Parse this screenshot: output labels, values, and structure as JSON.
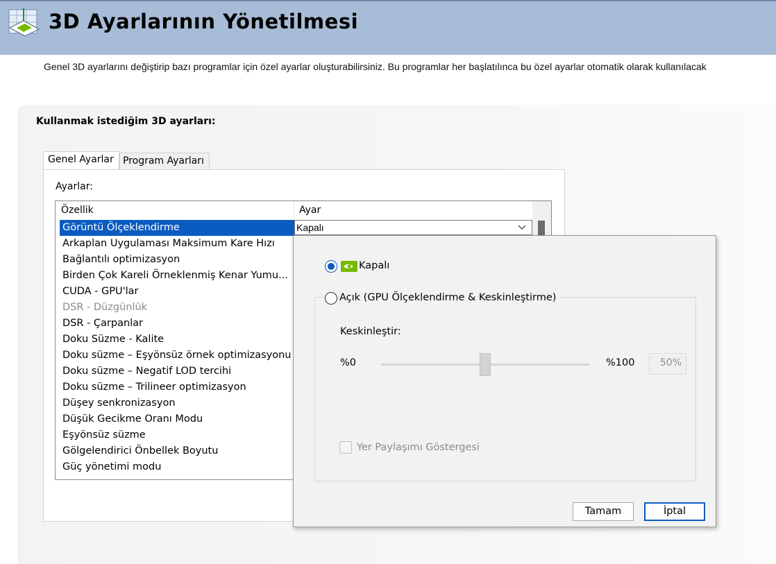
{
  "header": {
    "title": "3D Ayarlarının Yönetilmesi",
    "logo_icon": "nvidia-3d-settings-icon"
  },
  "description": "Genel 3D ayarlarını değiştirip bazı programlar için özel ayarlar oluşturabilirsiniz. Bu programlar her başlatılınca bu özel ayarlar otomatik olarak kullanılacak",
  "section_label": "Kullanmak istediğim 3D ayarları:",
  "tabs": [
    {
      "label": "Genel Ayarlar"
    },
    {
      "label": "Program Ayarları"
    }
  ],
  "settings_label": "Ayarlar:",
  "table": {
    "headers": {
      "feature": "Özellik",
      "setting": "Ayar"
    },
    "rows": [
      {
        "label": "Görüntü Ölçeklendirme",
        "selected": true
      },
      {
        "label": "Arkaplan Uygulaması Maksimum Kare Hızı"
      },
      {
        "label": "Bağlantılı optimizasyon"
      },
      {
        "label": "Birden Çok Kareli Örneklenmiş Kenar Yumu..."
      },
      {
        "label": "CUDA - GPU'lar"
      },
      {
        "label": "DSR - Düzgünlük",
        "disabled": true
      },
      {
        "label": "DSR - Çarpanlar"
      },
      {
        "label": "Doku Süzme - Kalite"
      },
      {
        "label": "Doku süzme – Eşyönsüz örnek optimizasyonu"
      },
      {
        "label": "Doku süzme – Negatif LOD tercihi"
      },
      {
        "label": "Doku süzme – Trilineer optimizasyon"
      },
      {
        "label": "Düşey senkronizasyon"
      },
      {
        "label": "Düşük Gecikme Oranı Modu"
      },
      {
        "label": "Eşyönsüz süzme"
      },
      {
        "label": "Gölgelendirici Önbellek Boyutu"
      },
      {
        "label": "Güç yönetimi modu"
      }
    ],
    "selected_value": "Kapalı"
  },
  "popup": {
    "option_off": "Kapalı",
    "option_on": "Açık (GPU Ölçeklendirme & Keskinleştirme)",
    "selected_option": "off",
    "sharpen_label": "Keskinleştir:",
    "min_label": "%0",
    "max_label": "%100",
    "value_text": "50%",
    "slider_value": 0.5,
    "overlay_checkbox_label": "Yer Paylaşımı Göstergesi",
    "ok_label": "Tamam",
    "cancel_label": "İptal"
  },
  "colors": {
    "header_bg": "#a7bcd6",
    "selection": "#0a5cc1",
    "nvidia_green": "#76b900"
  }
}
